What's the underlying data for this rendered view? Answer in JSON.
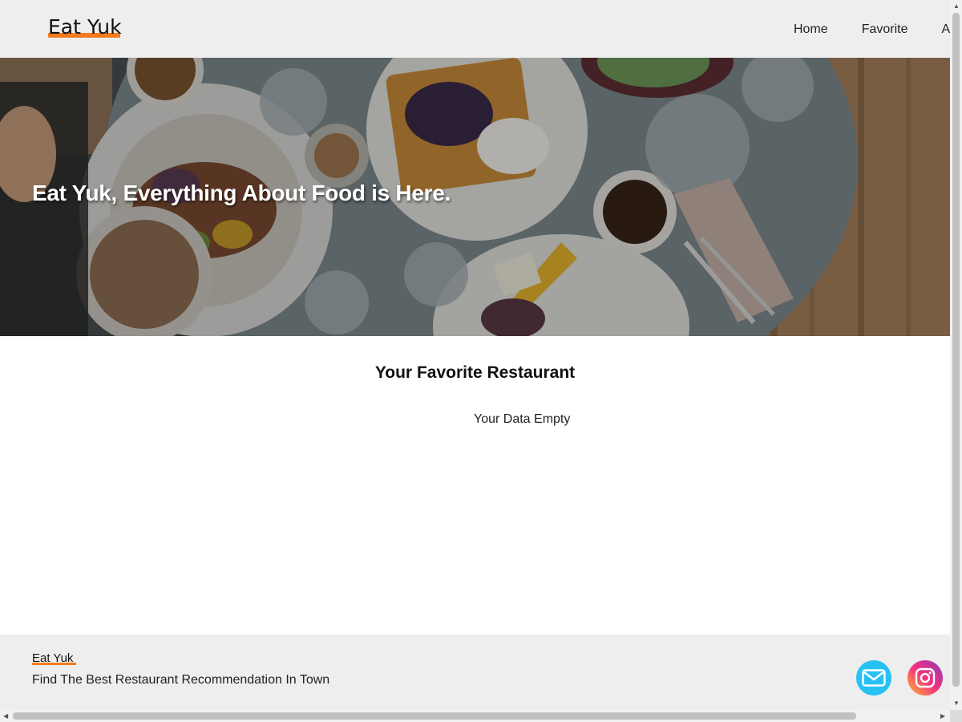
{
  "header": {
    "logo": "Eat Yuk",
    "nav": [
      "Home",
      "Favorite",
      "A"
    ]
  },
  "hero": {
    "title": "Eat Yuk, Everything About Food is Here.",
    "image": "food-table-photo"
  },
  "main": {
    "title": "Your Favorite Restaurant",
    "empty_message": "Your Data Empty"
  },
  "footer": {
    "logo": "Eat Yuk",
    "tagline": "Find The Best Restaurant Recommendation In Town",
    "social": [
      "mail-icon",
      "instagram-icon"
    ]
  },
  "colors": {
    "accent": "#f47b20",
    "header_bg": "#eeeeee",
    "mail": "#27c2f3"
  }
}
